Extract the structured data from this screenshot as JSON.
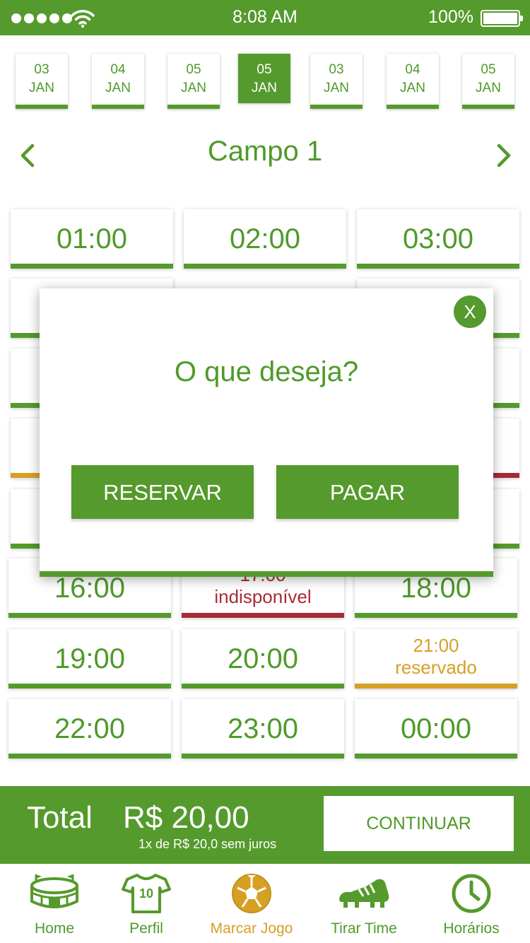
{
  "status_bar": {
    "time": "8:08 AM",
    "battery": "100%"
  },
  "dates": [
    {
      "day": "03",
      "month": "JAN"
    },
    {
      "day": "04",
      "month": "JAN"
    },
    {
      "day": "05",
      "month": "JAN"
    },
    {
      "day": "05",
      "month": "JAN",
      "selected": true
    },
    {
      "day": "03",
      "month": "JAN"
    },
    {
      "day": "04",
      "month": "JAN"
    },
    {
      "day": "05",
      "month": "JAN"
    }
  ],
  "field": {
    "title": "Campo 1"
  },
  "slots": [
    {
      "time": "01:00",
      "status": "available"
    },
    {
      "time": "02:00",
      "status": "available"
    },
    {
      "time": "03:00",
      "status": "available"
    },
    {
      "time": "16:00",
      "status": "available"
    },
    {
      "time": "17:00",
      "status": "unavailable",
      "status_label": "indisponível"
    },
    {
      "time": "18:00",
      "status": "available"
    },
    {
      "time": "19:00",
      "status": "available"
    },
    {
      "time": "20:00",
      "status": "available"
    },
    {
      "time": "21:00",
      "status": "reserved",
      "status_label": "reservado"
    },
    {
      "time": "22:00",
      "status": "available"
    },
    {
      "time": "23:00",
      "status": "available"
    },
    {
      "time": "00:00",
      "status": "available"
    }
  ],
  "modal": {
    "close_label": "X",
    "question": "O que deseja?",
    "reserve_label": "RESERVAR",
    "pay_label": "PAGAR"
  },
  "total": {
    "label": "Total",
    "price": "R$ 20,00",
    "installments": "1x de R$ 20,0 sem juros",
    "continue_label": "CONTINUAR"
  },
  "nav": [
    {
      "label": "Home",
      "icon": "stadium-icon"
    },
    {
      "label": "Perfil",
      "icon": "jersey-icon"
    },
    {
      "label": "Marcar Jogo",
      "icon": "soccer-ball-icon",
      "active": true
    },
    {
      "label": "Tirar Time",
      "icon": "cleat-icon"
    },
    {
      "label": "Horários",
      "icon": "clock-icon"
    }
  ],
  "colors": {
    "primary": "#559a2c",
    "text_green": "#4f9a2a",
    "reserved": "#d6a025",
    "unavailable": "#a82a36",
    "white": "#ffffff"
  }
}
